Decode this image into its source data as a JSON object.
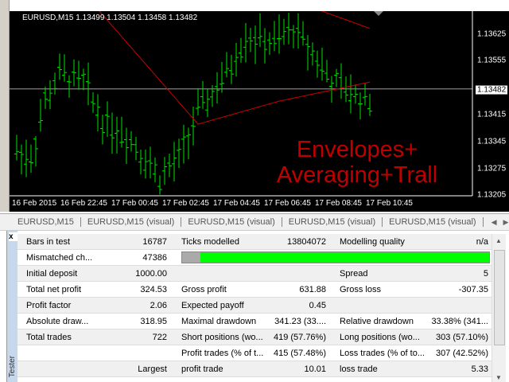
{
  "chart": {
    "symbol_info": "EURUSD,M15  1.13499 1.13504 1.13458 1.13482",
    "time_labels": [
      "16 Feb 2015",
      "16 Feb 22:45",
      "17 Feb 00:45",
      "17 Feb 02:45",
      "17 Feb 04:45",
      "17 Feb 06:45",
      "17 Feb 08:45",
      "17 Feb 10:45"
    ],
    "price_labels": [
      "1.13625",
      "1.13555",
      "1.13482",
      "1.13415",
      "1.13345",
      "1.13275",
      "1.13205"
    ],
    "current_price": "1.13482",
    "overlay_text": [
      "Envelopes+",
      "Averaging+Trall"
    ],
    "colors": {
      "bull": "#00e000",
      "ma": "#cc0000",
      "price_line": "#a0a0a0",
      "overlay": "#c00000"
    },
    "chart_data": {
      "type": "bar",
      "price_path": [
        [
          0,
          1.1332
        ],
        [
          3,
          1.133
        ],
        [
          6,
          1.1345
        ],
        [
          9,
          1.1352
        ],
        [
          14,
          1.135
        ],
        [
          18,
          1.134
        ],
        [
          24,
          1.1335
        ],
        [
          30,
          1.1325
        ],
        [
          34,
          1.133
        ],
        [
          38,
          1.1342
        ],
        [
          44,
          1.1352
        ],
        [
          48,
          1.1362
        ],
        [
          54,
          1.136
        ],
        [
          58,
          1.1364
        ],
        [
          62,
          1.1358
        ],
        [
          66,
          1.135
        ],
        [
          70,
          1.1347
        ],
        [
          74,
          1.1345
        ]
      ],
      "ma_path": [
        [
          17,
          1.1369
        ],
        [
          38,
          1.1339
        ],
        [
          55,
          1.1345
        ],
        [
          74,
          1.135
        ]
      ],
      "upper_envelope": [
        [
          63,
          1.1369
        ],
        [
          74,
          1.1364
        ]
      ],
      "ylim": [
        1.1318,
        1.1369
      ]
    }
  },
  "tabs": [
    "EURUSD,M15",
    "EURUSD,M15 (visual)",
    "EURUSD,M15 (visual)",
    "EURUSD,M15 (visual)",
    "EURUSD,M15 (visual)"
  ],
  "side_panel": {
    "close": "x",
    "title": "Tester"
  },
  "report": {
    "rows": [
      [
        "Bars in test",
        "16787",
        "Ticks modelled",
        "13804072",
        "Modelling quality",
        "n/a"
      ],
      [
        "Mismatched ch...",
        "47386",
        "",
        "",
        "",
        ""
      ],
      [
        "Initial deposit",
        "1000.00",
        "",
        "",
        "Spread",
        "5"
      ],
      [
        "Total net profit",
        "324.53",
        "Gross profit",
        "631.88",
        "Gross loss",
        "-307.35"
      ],
      [
        "Profit factor",
        "2.06",
        "Expected payoff",
        "0.45",
        "",
        ""
      ],
      [
        "Absolute draw...",
        "318.95",
        "Maximal drawdown",
        "341.23 (33....",
        "Relative drawdown",
        "33.38% (341..."
      ],
      [
        "Total trades",
        "722",
        "Short positions (wo...",
        "419 (57.76%)",
        "Long positions (wo...",
        "303 (57.10%)"
      ],
      [
        "",
        "",
        "Profit trades (% of t...",
        "415 (57.48%)",
        "Loss trades (% of to...",
        "307 (42.52%)"
      ],
      [
        "",
        "Largest",
        "profit trade",
        "10.01",
        "loss trade",
        "5.33"
      ]
    ],
    "modelling_quality_fraction": 0.94,
    "mismatched_bar_gray_fraction": 0.06
  }
}
